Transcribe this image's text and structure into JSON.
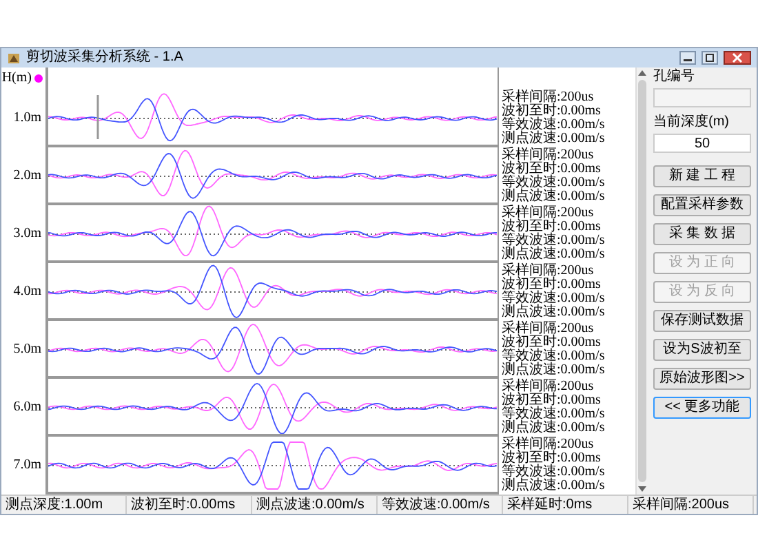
{
  "window": {
    "title": "剪切波采集分析系统 - 1.A"
  },
  "axis_label": "H(m)",
  "traces": [
    {
      "depth": "1.0m",
      "cursor": true,
      "info": [
        "采样间隔:200us",
        "波初至时:0.00ms",
        "等效波速:0.00m/s",
        "测点波速:0.00m/s"
      ]
    },
    {
      "depth": "2.0m",
      "cursor": false,
      "info": [
        "采样间隔:200us",
        "波初至时:0.00ms",
        "等效波速:0.00m/s",
        "测点波速:0.00m/s"
      ]
    },
    {
      "depth": "3.0m",
      "cursor": false,
      "info": [
        "采样间隔:200us",
        "波初至时:0.00ms",
        "等效波速:0.00m/s",
        "测点波速:0.00m/s"
      ]
    },
    {
      "depth": "4.0m",
      "cursor": false,
      "info": [
        "采样间隔:200us",
        "波初至时:0.00ms",
        "等效波速:0.00m/s",
        "测点波速:0.00m/s"
      ]
    },
    {
      "depth": "5.0m",
      "cursor": false,
      "info": [
        "采样间隔:200us",
        "波初至时:0.00ms",
        "等效波速:0.00m/s",
        "测点波速:0.00m/s"
      ]
    },
    {
      "depth": "6.0m",
      "cursor": false,
      "info": [
        "采样间隔:200us",
        "波初至时:0.00ms",
        "等效波速:0.00m/s",
        "测点波速:0.00m/s"
      ]
    },
    {
      "depth": "7.0m",
      "cursor": false,
      "info": [
        "采样间隔:200us",
        "波初至时:0.00ms",
        "等效波速:0.00m/s",
        "测点波速:0.00m/s"
      ]
    }
  ],
  "panel": {
    "hole_label": "孔编号",
    "depth_label": "当前深度(m)",
    "depth_value": "50"
  },
  "buttons": [
    {
      "label": "新 建 工 程",
      "disabled": false,
      "focused": false
    },
    {
      "label": "配置采样参数",
      "disabled": false,
      "focused": false
    },
    {
      "label": "采 集 数 据",
      "disabled": false,
      "focused": false
    },
    {
      "label": "设 为 正 向",
      "disabled": true,
      "focused": false
    },
    {
      "label": "设 为 反 向",
      "disabled": true,
      "focused": false
    },
    {
      "label": "保存测试数据",
      "disabled": false,
      "focused": false
    },
    {
      "label": "设为S波初至",
      "disabled": false,
      "focused": false
    },
    {
      "label": "原始波形图>>",
      "disabled": false,
      "focused": false
    },
    {
      "label": "<< 更多功能",
      "disabled": false,
      "focused": true
    }
  ],
  "status_bar": [
    "测点深度:1.00m",
    "波初至时:0.00ms",
    "测点波速:0.00m/s",
    "等效波速:0.00m/s",
    "采样延时:0ms",
    "采样间隔:200us"
  ]
}
